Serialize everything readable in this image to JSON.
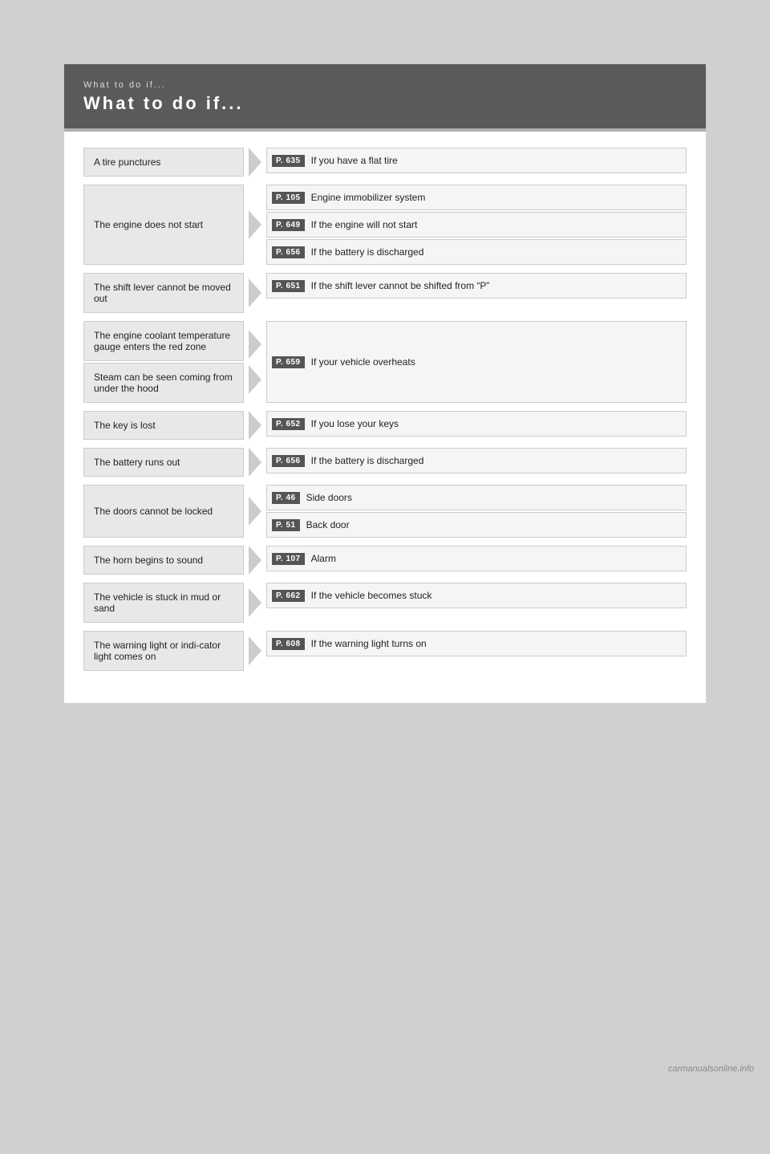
{
  "header": {
    "small_title": "What to do if...",
    "large_title": "What to do if..."
  },
  "entries": [
    {
      "id": "tire",
      "left_items": [
        "A tire punctures"
      ],
      "right_items": [
        {
          "page": "P. 635",
          "text": "If you have a flat tire"
        }
      ]
    },
    {
      "id": "engine-start",
      "left_items": [
        "The engine does not start"
      ],
      "right_items": [
        {
          "page": "P. 105",
          "text": "Engine immobilizer system"
        },
        {
          "page": "P. 649",
          "text": "If the engine will not start"
        },
        {
          "page": "P. 656",
          "text": "If the battery is discharged"
        }
      ]
    },
    {
      "id": "shift-lever",
      "left_items": [
        "The shift lever cannot be moved out"
      ],
      "right_items": [
        {
          "page": "P. 651",
          "text": "If the shift lever cannot be shifted from “P”"
        }
      ]
    },
    {
      "id": "overheat",
      "left_items": [
        "The engine coolant temperature gauge enters the red zone",
        "Steam can be seen coming from under the hood"
      ],
      "right_items": [
        {
          "page": "P. 659",
          "text": "If your vehicle overheats"
        }
      ]
    },
    {
      "id": "key-lost",
      "left_items": [
        "The key is lost"
      ],
      "right_items": [
        {
          "page": "P. 652",
          "text": "If you lose your keys"
        }
      ]
    },
    {
      "id": "battery",
      "left_items": [
        "The battery runs out"
      ],
      "right_items": [
        {
          "page": "P. 656",
          "text": "If the battery is discharged"
        }
      ]
    },
    {
      "id": "doors",
      "left_items": [
        "The doors cannot be locked"
      ],
      "right_items": [
        {
          "page": "P. 46",
          "text": "Side doors"
        },
        {
          "page": "P. 51",
          "text": "Back door"
        }
      ]
    },
    {
      "id": "horn",
      "left_items": [
        "The horn begins to sound"
      ],
      "right_items": [
        {
          "page": "P. 107",
          "text": "Alarm"
        }
      ]
    },
    {
      "id": "stuck",
      "left_items": [
        "The vehicle is stuck in mud or sand"
      ],
      "right_items": [
        {
          "page": "P. 662",
          "text": "If the vehicle becomes stuck"
        }
      ]
    },
    {
      "id": "warning",
      "left_items": [
        "The warning light or indi-cator light comes on"
      ],
      "right_items": [
        {
          "page": "P. 608",
          "text": "If the warning light turns on"
        }
      ]
    }
  ],
  "watermark": "carmanualsonline.info"
}
